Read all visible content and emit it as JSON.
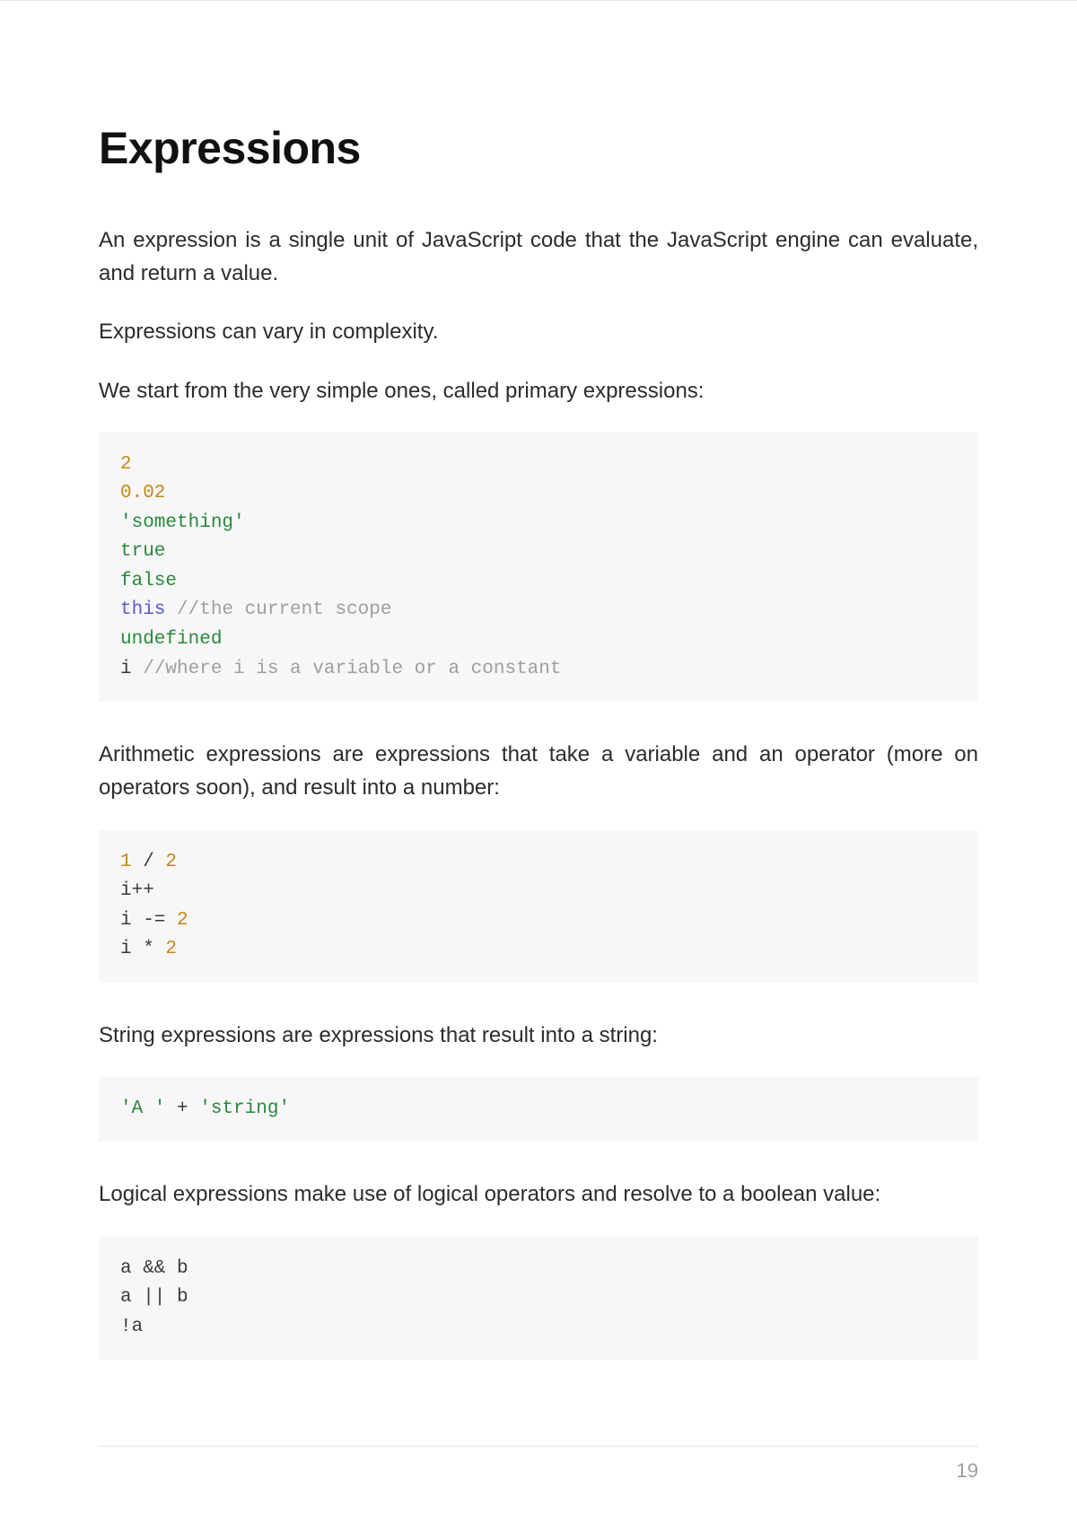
{
  "heading": "Expressions",
  "paragraphs": {
    "p1": "An expression is a single unit of JavaScript code that the JavaScript engine can evaluate, and return a value.",
    "p2": "Expressions can vary in complexity.",
    "p3": "We start from the very simple ones, called primary expressions:",
    "p4": "Arithmetic expressions are expressions that take a variable and an operator (more on operators soon), and result into a number:",
    "p5": "String expressions are expressions that result into a string:",
    "p6": "Logical expressions make use of logical operators and resolve to a boolean value:"
  },
  "code1": {
    "l1": "2",
    "l2": "0.02",
    "l3": "'something'",
    "l4": "true",
    "l5": "false",
    "l6a": "this",
    "l6b": " //the current scope",
    "l7": "undefined",
    "l8a": "i",
    "l8b": " //where i is a variable or a constant"
  },
  "code2": {
    "l1a": "1",
    "l1b": " / ",
    "l1c": "2",
    "l2": "i++",
    "l3a": "i -= ",
    "l3b": "2",
    "l4a": "i * ",
    "l4b": "2"
  },
  "code3": {
    "l1a": "'A '",
    "l1b": " + ",
    "l1c": "'string'"
  },
  "code4": {
    "l1": "a && b",
    "l2": "a || b",
    "l3": "!a"
  },
  "pageNumber": "19"
}
